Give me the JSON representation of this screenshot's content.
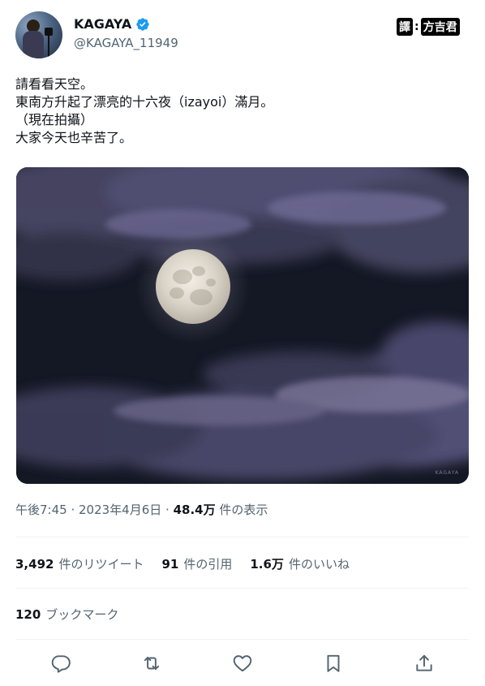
{
  "author": {
    "name": "KAGAYA",
    "handle": "@KAGAYA_11949"
  },
  "translator_badge": {
    "label": "譯",
    "separator": ":",
    "name": "方吉君"
  },
  "tweet": {
    "text": "請看看天空。\n東南方升起了漂亮的十六夜（izayoi）滿月。\n（現在拍攝）\n大家今天也辛苦了。"
  },
  "meta": {
    "time": "午後7:45",
    "separator": " · ",
    "date": "2023年4月6日",
    "views": "48.4万",
    "views_label": "件の表示"
  },
  "stats": {
    "retweets": "3,492",
    "retweets_label": "件のリツイート",
    "quotes": "91",
    "quotes_label": "件の引用",
    "likes": "1.6万",
    "likes_label": "件のいいね"
  },
  "bookmarks": {
    "count": "120",
    "label": "ブックマーク"
  },
  "photo": {
    "watermark": "KAGAYA"
  },
  "icons": {
    "verified": "verified-badge-icon",
    "reply": "reply-icon",
    "retweet": "retweet-icon",
    "like": "heart-icon",
    "bookmark": "bookmark-icon",
    "share": "share-icon"
  },
  "colors": {
    "verified": "#1d9bf0",
    "secondary_text": "#536471",
    "divider": "#eff3f4"
  }
}
